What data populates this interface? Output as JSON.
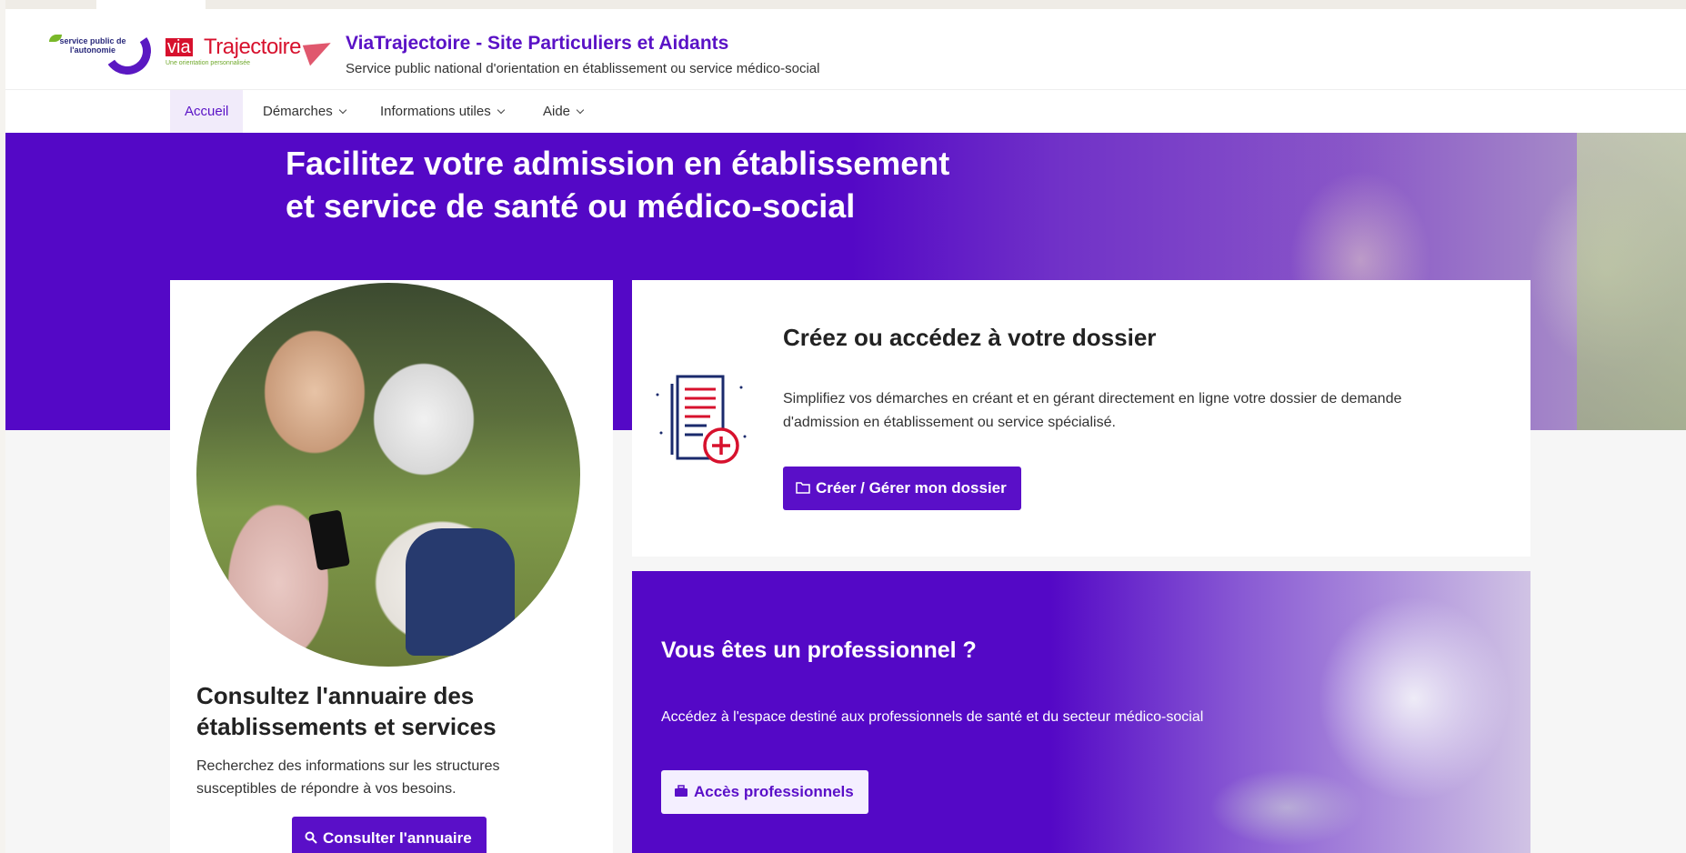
{
  "header": {
    "logo_spa_text": "service public de l'autonomie",
    "logo_via_text": "via",
    "logo_traj_text": "Trajectoire",
    "logo_via_sub": "Une orientation personnalisée",
    "title": "ViaTrajectoire - Site Particuliers et Aidants",
    "subtitle": "Service public national d'orientation en établissement ou service médico-social"
  },
  "nav": {
    "items": [
      {
        "label": "Accueil",
        "active": true
      },
      {
        "label": "Démarches",
        "dropdown": true
      },
      {
        "label": "Informations utiles",
        "dropdown": true
      },
      {
        "label": "Aide",
        "dropdown": true
      }
    ]
  },
  "hero": {
    "title_line1": "Facilitez votre admission en établissement",
    "title_line2": "et service de santé ou médico-social"
  },
  "annuaire": {
    "title": "Consultez l'annuaire des établissements et services",
    "text": "Recherchez des informations sur les structures susceptibles de répondre à vos besoins.",
    "button": "Consulter l'annuaire"
  },
  "dossier": {
    "title": "Créez ou accédez à votre dossier",
    "text": "Simplifiez vos démarches en créant et en gérant directement en ligne votre dossier de demande d'admission en établissement ou service spécialisé.",
    "button": "Créer / Gérer mon dossier"
  },
  "professionnel": {
    "title": "Vous êtes un professionnel ?",
    "text": "Accédez à l'espace destiné aux professionnels de santé et du secteur médico-social",
    "button": "Accès professionnels"
  },
  "colors": {
    "brand_purple": "#5408c6",
    "button_purple": "#5a0fc8",
    "logo_red": "#d7112d"
  }
}
